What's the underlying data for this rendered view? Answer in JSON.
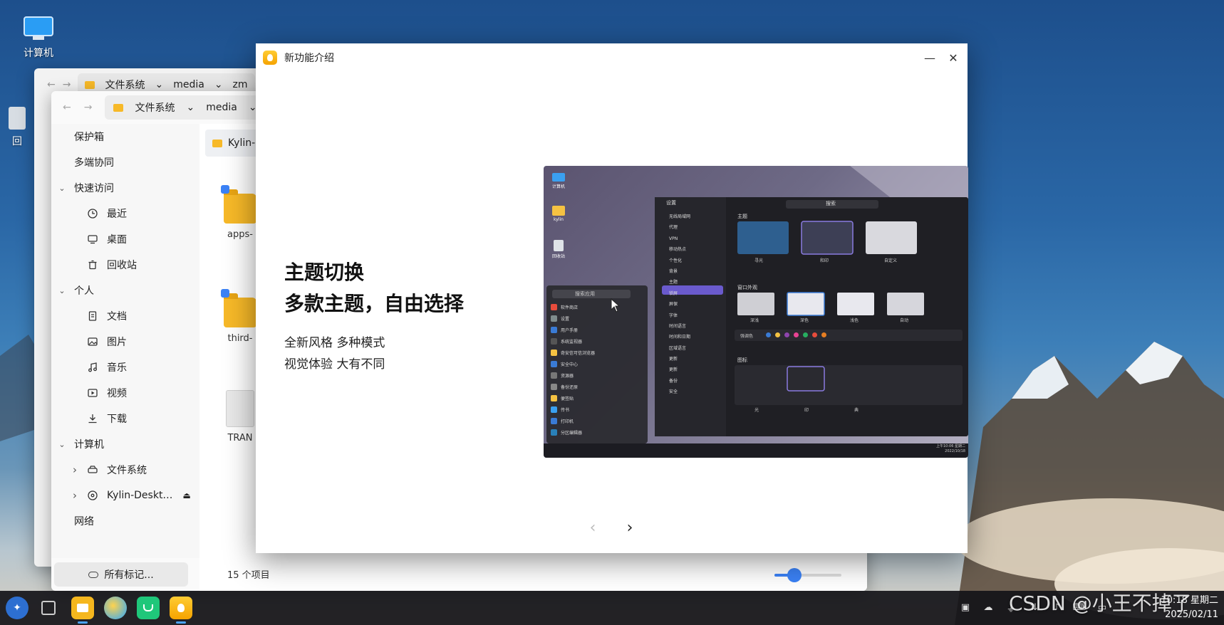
{
  "desktop": {
    "icons": [
      {
        "label": "计算机",
        "icon": "computer-icon"
      },
      {
        "label": "回",
        "icon": "recycle-bin-icon"
      }
    ]
  },
  "file_manager_back": {
    "breadcrumbs": [
      "文件系统",
      "media",
      "zm"
    ]
  },
  "file_manager": {
    "breadcrumbs": [
      "文件系统",
      "media"
    ],
    "sidebar": {
      "items": [
        {
          "label": "保护箱",
          "level": 0,
          "expand": "",
          "icon": ""
        },
        {
          "label": "多端协同",
          "level": 0,
          "expand": "",
          "icon": ""
        },
        {
          "label": "快速访问",
          "level": 0,
          "expand": "down",
          "icon": ""
        },
        {
          "label": "最近",
          "level": 1,
          "expand": "",
          "icon": "clock-icon"
        },
        {
          "label": "桌面",
          "level": 1,
          "expand": "",
          "icon": "desktop-icon"
        },
        {
          "label": "回收站",
          "level": 1,
          "expand": "",
          "icon": "trash-icon"
        },
        {
          "label": "个人",
          "level": 0,
          "expand": "down",
          "icon": ""
        },
        {
          "label": "文档",
          "level": 1,
          "expand": "",
          "icon": "document-icon"
        },
        {
          "label": "图片",
          "level": 1,
          "expand": "",
          "icon": "picture-icon"
        },
        {
          "label": "音乐",
          "level": 1,
          "expand": "",
          "icon": "music-icon"
        },
        {
          "label": "视频",
          "level": 1,
          "expand": "",
          "icon": "video-icon"
        },
        {
          "label": "下载",
          "level": 1,
          "expand": "",
          "icon": "download-icon"
        },
        {
          "label": "计算机",
          "level": 0,
          "expand": "down",
          "icon": ""
        },
        {
          "label": "文件系统",
          "level": 1,
          "expand": "right",
          "icon": "drive-icon"
        },
        {
          "label": "Kylin-Deskt…",
          "level": 1,
          "expand": "right",
          "icon": "disc-icon"
        },
        {
          "label": "网络",
          "level": 0,
          "expand": "",
          "icon": ""
        }
      ]
    },
    "tab_label": "Kylin-D",
    "files": [
      {
        "name": "apps-",
        "type": "folder"
      },
      {
        "name": "third-",
        "type": "folder"
      },
      {
        "name": "TRAN",
        "type": "file"
      }
    ],
    "all_tags_label": "所有标记...",
    "item_count": "15 个项目",
    "zoom_level": 0.3
  },
  "dialog": {
    "title": "新功能介绍",
    "heading_line1": "主题切换",
    "heading_line2": "多款主题，自由选择",
    "body_line1": "全新风格 多种模式",
    "body_line2": "视觉体验 大有不同",
    "preview": {
      "desktop_labels": [
        "计算机",
        "kylin",
        "回收站"
      ],
      "search_apps": "搜索应用",
      "app_list": [
        "软件商店",
        "设置",
        "用户手册",
        "系统监视器",
        "奇安信可信浏览器",
        "安全中心",
        "资源器",
        "备份还原",
        "便签贴",
        "传书",
        "打印机",
        "分区编辑器"
      ],
      "settings_title": "设置",
      "settings_search": "搜索",
      "settings_menu": [
        "无线局域网",
        "代理",
        "VPN",
        "移动热点",
        "个性化",
        "背景",
        "主题",
        "锁屏",
        "屏保",
        "字体",
        "时间语言",
        "时间和日期",
        "区域语言",
        "更新",
        "更新",
        "备份",
        "安全"
      ],
      "section_theme": "主题",
      "themes": [
        "寻光",
        "和印",
        "自定义"
      ],
      "section_window": "窗口外观",
      "window_styles": [
        "深浅",
        "深色",
        "浅色",
        "自动"
      ],
      "accent_label": "强调色",
      "accent_colors": [
        "#3a7bd5",
        "#f5c242",
        "#8e44ad",
        "#e84393",
        "#27ae60",
        "#e74c3c",
        "#e67e22"
      ],
      "section_icons": "图标",
      "icon_sets": [
        "光",
        "印",
        "典"
      ],
      "clock_line1": "上午10:06 星期二",
      "clock_line2": "2022/10/18"
    }
  },
  "taskbar": {
    "apps": [
      {
        "icon": "start-menu-icon",
        "active": false
      },
      {
        "icon": "multitask-icon",
        "active": false
      },
      {
        "icon": "file-manager-icon",
        "active": true
      },
      {
        "icon": "browser-icon",
        "active": false
      },
      {
        "icon": "software-store-icon",
        "active": false
      },
      {
        "icon": "new-features-icon",
        "active": true
      }
    ],
    "clock_time": "10:18 星期二",
    "clock_date": "2025/02/11"
  },
  "watermark": "CSDN @小王不掉了"
}
